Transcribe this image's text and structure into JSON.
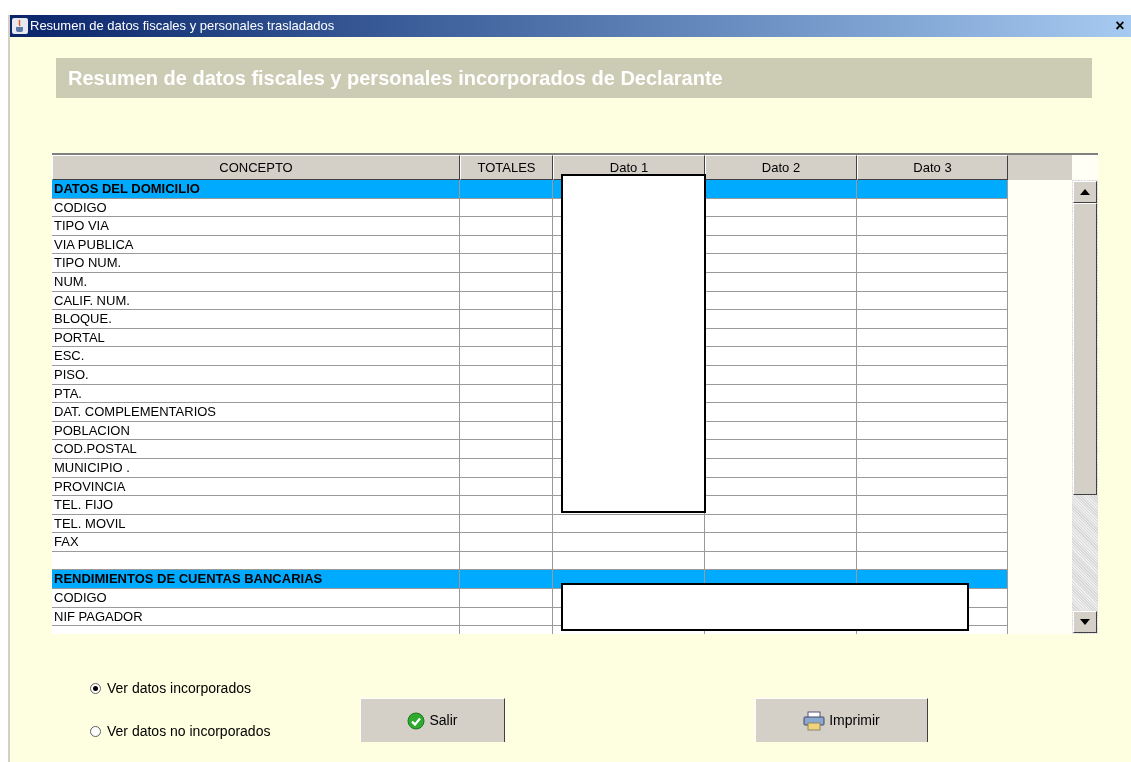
{
  "window": {
    "title": "Resumen de datos fiscales y personales trasladados",
    "close": "×"
  },
  "banner": "Resumen de datos fiscales y personales incorporados de Declarante",
  "table": {
    "columns": [
      "CONCEPTO",
      "TOTALES",
      "Dato 1",
      "Dato 2",
      "Dato 3"
    ],
    "rows": [
      {
        "kind": "section",
        "label": "DATOS DEL DOMICILIO"
      },
      {
        "kind": "item",
        "label": "CODIGO"
      },
      {
        "kind": "item",
        "label": "TIPO VIA"
      },
      {
        "kind": "item",
        "label": "VIA PUBLICA"
      },
      {
        "kind": "item",
        "label": "TIPO NUM."
      },
      {
        "kind": "item",
        "label": "NUM."
      },
      {
        "kind": "item",
        "label": "CALIF. NUM."
      },
      {
        "kind": "item",
        "label": "BLOQUE."
      },
      {
        "kind": "item",
        "label": "PORTAL"
      },
      {
        "kind": "item",
        "label": "ESC."
      },
      {
        "kind": "item",
        "label": "PISO."
      },
      {
        "kind": "item",
        "label": "PTA."
      },
      {
        "kind": "item",
        "label": "DAT. COMPLEMENTARIOS"
      },
      {
        "kind": "item",
        "label": "POBLACION"
      },
      {
        "kind": "item",
        "label": "COD.POSTAL"
      },
      {
        "kind": "item",
        "label": "MUNICIPIO   ."
      },
      {
        "kind": "item",
        "label": "PROVINCIA"
      },
      {
        "kind": "item",
        "label": "TEL. FIJO"
      },
      {
        "kind": "item",
        "label": "TEL. MOVIL"
      },
      {
        "kind": "item",
        "label": "FAX"
      },
      {
        "kind": "blank"
      },
      {
        "kind": "section",
        "label": "RENDIMIENTOS DE CUENTAS BANCARIAS"
      },
      {
        "kind": "item",
        "label": "CODIGO"
      },
      {
        "kind": "item",
        "label": "NIF PAGADOR"
      },
      {
        "kind": "blank"
      }
    ]
  },
  "view_options": [
    {
      "label": "Ver datos incorporados",
      "selected": true
    },
    {
      "label": "Ver datos no incorporados",
      "selected": false
    }
  ],
  "buttons": [
    {
      "kind": "exit",
      "label": "Salir"
    },
    {
      "kind": "print",
      "label": "Imprimir"
    }
  ]
}
